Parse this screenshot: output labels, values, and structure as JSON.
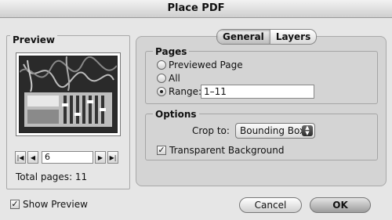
{
  "window": {
    "title": "Place PDF"
  },
  "preview": {
    "label": "Preview",
    "page_value": "6",
    "total_pages": "Total pages: 11",
    "show_preview_label": "Show Preview",
    "show_preview_checked": true
  },
  "tabs": [
    {
      "label": "General",
      "active": true
    },
    {
      "label": "Layers",
      "active": false
    }
  ],
  "pages": {
    "title": "Pages",
    "options": [
      {
        "label": "Previewed Page",
        "selected": false
      },
      {
        "label": "All",
        "selected": false
      },
      {
        "label": "Range:",
        "selected": true
      }
    ],
    "range_value": "1–11"
  },
  "options": {
    "title": "Options",
    "crop_label": "Crop to:",
    "crop_value": "Bounding Box",
    "transparent_label": "Transparent Background",
    "transparent_checked": true
  },
  "buttons": {
    "cancel": "Cancel",
    "ok": "OK"
  }
}
